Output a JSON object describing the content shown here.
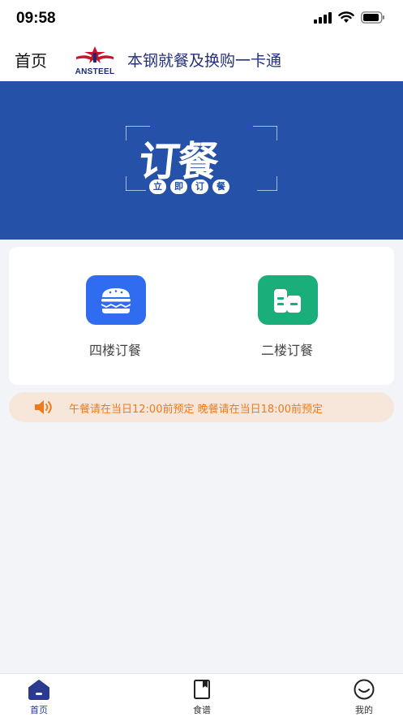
{
  "status_bar": {
    "time": "09:58"
  },
  "header": {
    "page_title": "首页",
    "logo_text": "ANSTEEL",
    "app_title": "本钢就餐及换购一卡通"
  },
  "banner": {
    "main_text": "订餐",
    "sub_chars": [
      "立",
      "即",
      "订",
      "餐"
    ]
  },
  "order_options": [
    {
      "label": "四楼订餐",
      "icon": "burger-icon",
      "color": "#2f6cf0"
    },
    {
      "label": "二楼订餐",
      "icon": "building-icon",
      "color": "#1aae7a"
    }
  ],
  "notice": {
    "icon": "speaker-icon",
    "text": "午餐请在当日12:00前预定 晚餐请在当日18:00前预定"
  },
  "tab_bar": {
    "tabs": [
      {
        "label": "首页",
        "icon": "home-icon",
        "active": true
      },
      {
        "label": "食谱",
        "icon": "recipe-book-icon",
        "active": false
      },
      {
        "label": "我的",
        "icon": "profile-smile-icon",
        "active": false
      }
    ]
  },
  "colors": {
    "banner": "#2552a8",
    "brand_title": "#23317a",
    "notice_text": "#ee7a1c",
    "notice_bg": "#f7e7db",
    "tab_active": "#2a3b8f"
  }
}
